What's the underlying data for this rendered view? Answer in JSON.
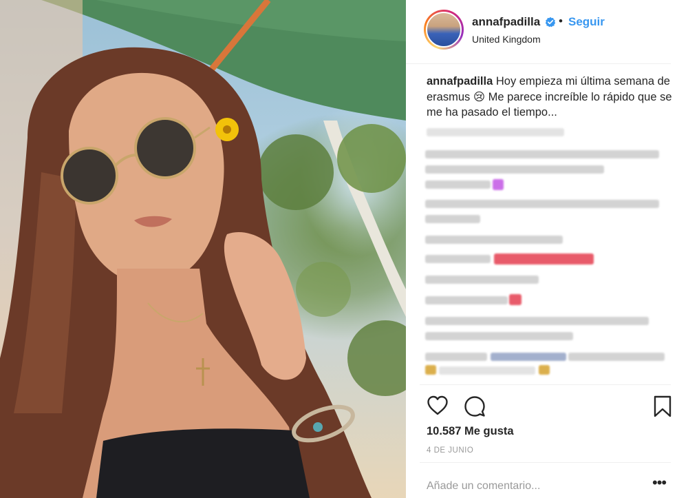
{
  "post": {
    "username": "annafpadilla",
    "follow_label": "Seguir",
    "separator": "•",
    "location": "United Kingdom",
    "caption_user": "annafpadilla",
    "caption_text": "Hoy empieza mi última semana de erasmus 😢 Me parece increíble lo rápido que se me ha pasado el tiempo...",
    "likes_text": "10.587 Me gusta",
    "date": "4 DE JUNIO",
    "comment_placeholder": "Añade un comentario...",
    "more_options": "•••"
  },
  "icons": {
    "verified": "verified-badge-icon",
    "like": "heart-icon",
    "comment": "comment-bubble-icon",
    "save": "bookmark-icon",
    "more": "more-options-icon"
  },
  "colors": {
    "follow": "#3897f0",
    "verified": "#3897f0",
    "text": "#262626",
    "muted": "#999999"
  }
}
